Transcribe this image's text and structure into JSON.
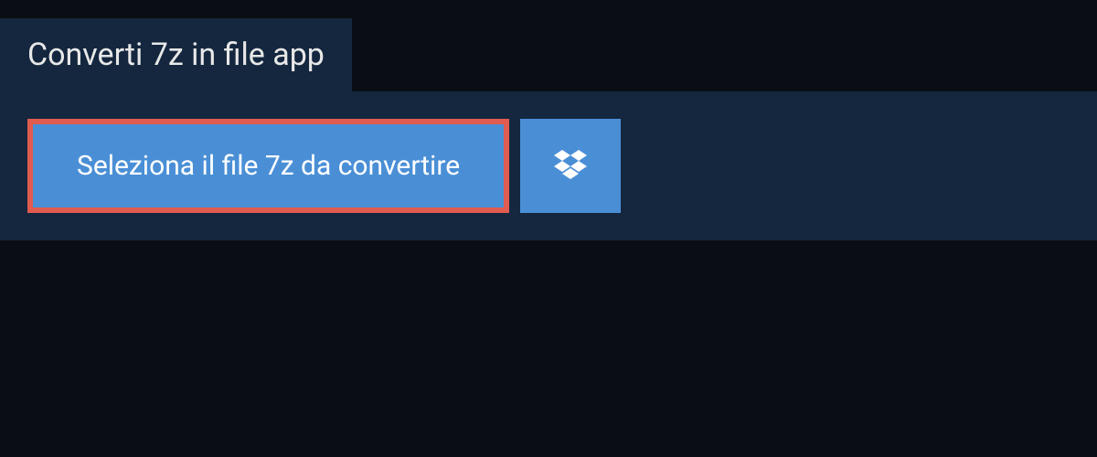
{
  "header": {
    "title": "Converti 7z in file app"
  },
  "actions": {
    "select_file_label": "Seleziona il file 7z da convertire"
  },
  "colors": {
    "background_dark": "#0a0e14",
    "panel": "#14273f",
    "button_primary": "#4a8fd6",
    "highlight_border": "#e05c50",
    "text_light": "#e8e8e8",
    "text_white": "#ffffff"
  }
}
